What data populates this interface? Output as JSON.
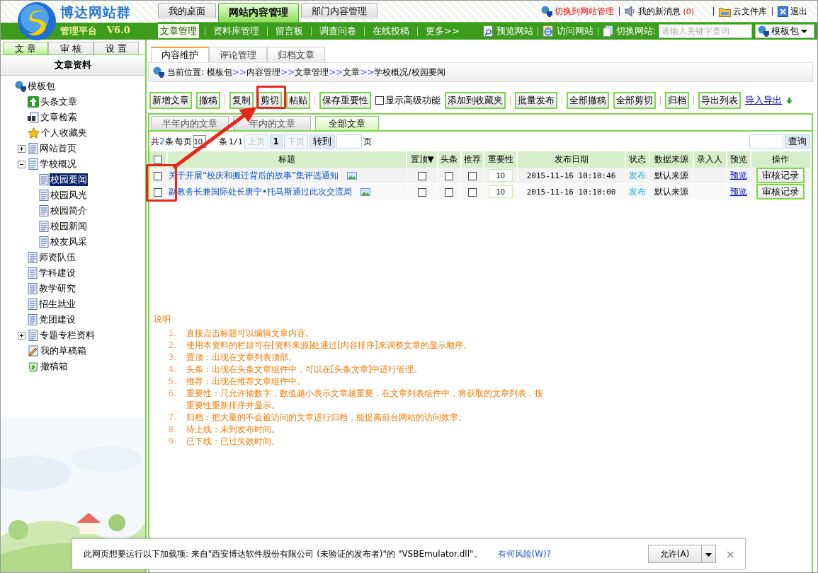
{
  "header": {
    "logo": {
      "name": "博达网站群",
      "subtitle": "管理平台",
      "version": "V6.0"
    },
    "top_tabs": [
      {
        "label": "我的桌面",
        "selected": false
      },
      {
        "label": "网站内容管理",
        "selected": true
      },
      {
        "label": "部门内容管理",
        "selected": false
      }
    ],
    "top_links": [
      {
        "kind": "switch",
        "label": "切换到网站管理"
      },
      {
        "kind": "messages",
        "label": "我的新消息",
        "count": "(0)"
      },
      {
        "kind": "cloud",
        "label": "云文件库"
      },
      {
        "kind": "exit",
        "label": "退出"
      }
    ],
    "nav_menu": [
      {
        "label": "文章管理",
        "selected": true
      },
      {
        "label": "资料库管理",
        "selected": false
      },
      {
        "label": "留言板",
        "selected": false
      },
      {
        "label": "调查问卷",
        "selected": false
      },
      {
        "label": "在线投稿",
        "selected": false
      },
      {
        "label": "更多>>",
        "selected": false
      }
    ],
    "nav_tools": [
      {
        "kind": "preview",
        "label": "预览网站"
      },
      {
        "kind": "visit",
        "label": "访问网站"
      }
    ],
    "site_switch": {
      "label": "切换网站:",
      "placeholder": "请输入关键字查询",
      "site": "模板包"
    }
  },
  "sidebar": {
    "tabs": [
      {
        "label": "文 章",
        "selected": true
      },
      {
        "label": "审 核",
        "selected": false
      },
      {
        "label": "设 置",
        "selected": false
      }
    ],
    "title": "文章资料",
    "tree": {
      "kind": "root",
      "label": "模板包",
      "selected": false,
      "children": [
        {
          "kind": "headline",
          "label": "头条文章",
          "selected": false
        },
        {
          "kind": "search",
          "label": "文章检索",
          "selected": false
        },
        {
          "kind": "favorite",
          "label": "个人收藏夹",
          "selected": false
        },
        {
          "kind": "page",
          "label": "网站首页",
          "selected": false,
          "expanded": false
        },
        {
          "kind": "page",
          "label": "学校概况",
          "selected": false,
          "expanded": true,
          "children": [
            {
              "kind": "page",
              "label": "校园要闻",
              "selected": true
            },
            {
              "kind": "page",
              "label": "校园风光",
              "selected": false
            },
            {
              "kind": "page",
              "label": "校园简介",
              "selected": false
            },
            {
              "kind": "page",
              "label": "校园新闻",
              "selected": false
            },
            {
              "kind": "page",
              "label": "校友风采",
              "selected": false
            }
          ]
        },
        {
          "kind": "page",
          "label": "师资队伍",
          "selected": false
        },
        {
          "kind": "page",
          "label": "学科建设",
          "selected": false
        },
        {
          "kind": "page",
          "label": "教学研究",
          "selected": false
        },
        {
          "kind": "page",
          "label": "招生就业",
          "selected": false
        },
        {
          "kind": "page",
          "label": "党团建设",
          "selected": false
        },
        {
          "kind": "page",
          "label": "专题专栏资料",
          "selected": false,
          "expanded": false
        },
        {
          "kind": "drafts",
          "label": "我的草稿箱",
          "selected": false
        },
        {
          "kind": "trash",
          "label": "撤稿箱",
          "selected": false
        }
      ]
    }
  },
  "content": {
    "tabs": [
      {
        "label": "内容维护",
        "selected": true
      },
      {
        "label": "评论管理",
        "selected": false
      },
      {
        "label": "归档文章",
        "selected": false
      }
    ],
    "breadcrumb": {
      "label": "当前位置:",
      "separator": ">>",
      "path": [
        "模板包",
        "内容管理",
        "文章管理",
        "文章",
        "学校概况/校园要闻"
      ]
    },
    "toolbar": [
      {
        "kind": "button",
        "label": "新增文章"
      },
      {
        "kind": "button",
        "label": "撤稿"
      },
      {
        "kind": "divider"
      },
      {
        "kind": "button",
        "label": "复制"
      },
      {
        "kind": "button",
        "label": "剪切"
      },
      {
        "kind": "button",
        "label": "粘贴"
      },
      {
        "kind": "divider"
      },
      {
        "kind": "button",
        "label": "保存重要性"
      },
      {
        "kind": "checkbox",
        "label": "显示高级功能",
        "checked": false
      },
      {
        "kind": "button",
        "label": "添加到收藏夹"
      },
      {
        "kind": "divider"
      },
      {
        "kind": "button",
        "label": "批量发布"
      },
      {
        "kind": "divider"
      },
      {
        "kind": "button",
        "label": "全部撤稿"
      },
      {
        "kind": "button",
        "label": "全部剪切"
      },
      {
        "kind": "divider"
      },
      {
        "kind": "button",
        "label": "归档"
      },
      {
        "kind": "divider"
      },
      {
        "kind": "button",
        "label": "导出列表"
      },
      {
        "kind": "link",
        "label": "导入导出"
      }
    ],
    "sub_tabs": [
      {
        "label": "半年内的文章",
        "selected": false
      },
      {
        "label": "年内的文章",
        "selected": false
      },
      {
        "label": "全部文章",
        "selected": true
      }
    ],
    "pager": {
      "total_prefix": "共",
      "total": "2",
      "total_suffix": "条",
      "per_page_label": "每页",
      "per_page": "10",
      "per_page_suffix": "条",
      "pages": "1/1",
      "prev": "上页",
      "current": "1",
      "next": "下页",
      "goto": "转到",
      "page_suffix": "页",
      "search_button": "查询"
    },
    "table": {
      "select_all": false,
      "columns": [
        "标题",
        "置顶▼",
        "头条",
        "推荐",
        "重要性",
        "发布日期",
        "状态",
        "数据来源",
        "录入人",
        "预览",
        "操作"
      ],
      "rows": [
        {
          "checked": false,
          "title": "关于开展“校庆和搬迁背后的故事”集评选通知",
          "pinned": false,
          "headline": false,
          "recommended": false,
          "importance": "10",
          "date": "2015-11-16  10:10:46",
          "status": "发布",
          "source": "默认来源",
          "preview": "预览",
          "action": "审核记录"
        },
        {
          "checked": false,
          "title": "副教务长兼国际处长唐宁•托马斯通过此次交流周",
          "pinned": false,
          "headline": false,
          "recommended": false,
          "importance": "10",
          "date": "2015-11-16  10:10:00",
          "status": "发布",
          "source": "默认来源",
          "preview": "预览",
          "action": "审核记录"
        }
      ]
    },
    "notes": {
      "title": "说明",
      "items": [
        {
          "number": "1.",
          "text": "直接点击标题可以编辑文章内容。"
        },
        {
          "number": "2.",
          "text": "使用本资料的栏目可在[资料来源]处通过[内容排序]来调整文章的显示顺序。"
        },
        {
          "number": "3.",
          "text": "置顶：出现在文章列表顶部。"
        },
        {
          "number": "4.",
          "text": "头条：出现在头条文章组件中，可以在[头条文章]中进行管理。"
        },
        {
          "number": "5.",
          "text": "推荐：出现在推荐文章组件中。"
        },
        {
          "number": "6.",
          "text": "重要性：只允许输数字，数值越小表示文章越重要，在文章列表组件中，将获取的文章列表，按重要性重新排序并显示。"
        },
        {
          "number": "7.",
          "text": "归档：把大量的不会被访问的文章进行归档，能提高前台网站的访问效率。"
        },
        {
          "number": "8.",
          "text": "待上线：未到发布时间。"
        },
        {
          "number": "9.",
          "text": "已下线：已过失效时间。"
        }
      ]
    }
  },
  "infobar": {
    "message": "此网页想要运行以下加载项: 来自\"西安博达软件股份有限公司 (未验证的发布者)\"的 \"VSBEmulator.dll\"。",
    "link": "有何风险(W)?",
    "button": "允许(A)",
    "close": "×"
  }
}
